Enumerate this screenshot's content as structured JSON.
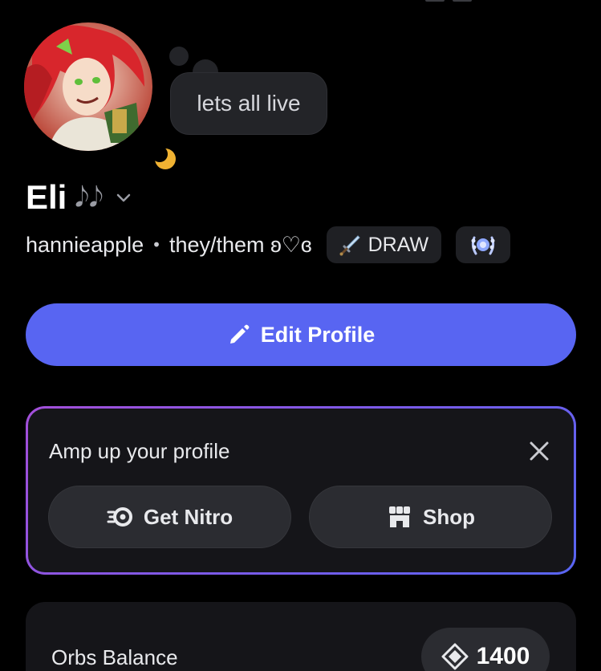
{
  "profile": {
    "status_text": "lets all live",
    "display_name": "Eli",
    "name_emoji": "𝅘𝅥𝅮𝅘𝅥𝅮",
    "username": "hannieapple",
    "separator": "•",
    "pronouns": "they/them ʚ♡ɞ",
    "tag_label": "DRAW"
  },
  "actions": {
    "edit_profile_label": "Edit Profile"
  },
  "amp_card": {
    "title": "Amp up your profile",
    "nitro_label": "Get Nitro",
    "shop_label": "Shop"
  },
  "orbs": {
    "label": "Orbs Balance",
    "balance": "1400"
  },
  "icons": {
    "status": "moon-icon",
    "tag": "sword-icon",
    "badge": "laurel-icon",
    "edit": "pencil-icon",
    "close": "close-icon",
    "nitro": "nitro-icon",
    "shop": "shop-icon",
    "orb": "orb-icon",
    "chevron": "chevron-down-icon"
  },
  "colors": {
    "background": "#000000",
    "accent": "#5865f2",
    "card": "#151519",
    "pill": "#2b2c31",
    "status_idle": "#f0b232",
    "gradient_start": "#a34fd9",
    "gradient_end": "#5865f2"
  }
}
